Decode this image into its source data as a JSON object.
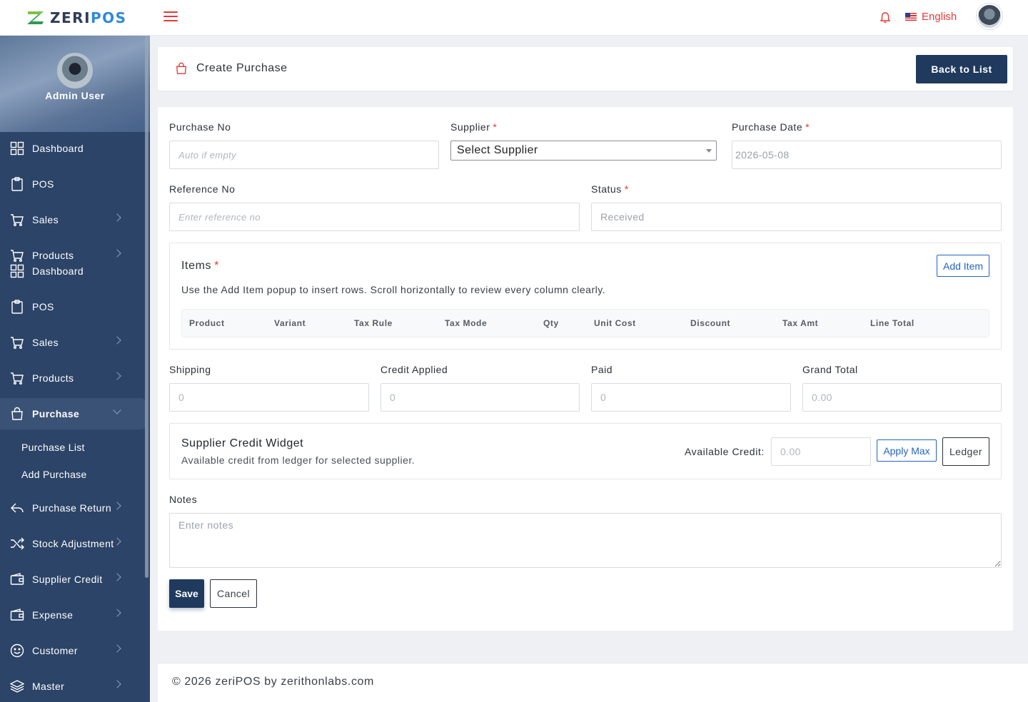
{
  "brand": {
    "part1": "ZERI",
    "part2": "POS"
  },
  "topbar": {
    "language": "English"
  },
  "profile": {
    "name": "Admin User"
  },
  "sidebar": {
    "items": [
      {
        "label": "Dashboard",
        "icon": "grid-icon"
      },
      {
        "label": "POS",
        "icon": "clipboard-icon"
      },
      {
        "label": "Sales",
        "icon": "cart-icon"
      },
      {
        "label": "Products",
        "icon": "cart-icon"
      },
      {
        "label": "Dashboard",
        "icon": "grid-icon"
      },
      {
        "label": "POS",
        "icon": "clipboard-icon"
      },
      {
        "label": "Sales",
        "icon": "cart-icon"
      },
      {
        "label": "Products",
        "icon": "cart-icon"
      },
      {
        "label": "Purchase",
        "icon": "bag-icon"
      },
      {
        "label": "Purchase Return",
        "icon": "return-icon"
      },
      {
        "label": "Stock Adjustment",
        "icon": "shuffle-icon"
      },
      {
        "label": "Supplier Credit",
        "icon": "wallet-icon"
      },
      {
        "label": "Expense",
        "icon": "wallet-icon"
      },
      {
        "label": "Customer",
        "icon": "smile-icon"
      },
      {
        "label": "Master",
        "icon": "layers-icon"
      }
    ],
    "purchase_sub": [
      "Purchase List",
      "Add Purchase"
    ]
  },
  "header": {
    "title": "Create Purchase",
    "back_label": "Back to List"
  },
  "form": {
    "purchase_no": {
      "label": "Purchase No",
      "placeholder": "Auto if empty"
    },
    "supplier": {
      "label": "Supplier",
      "value": "Select Supplier"
    },
    "purchase_date": {
      "label": "Purchase Date",
      "value": "2026-05-08"
    },
    "reference_no": {
      "label": "Reference No",
      "placeholder": "Enter reference no"
    },
    "status": {
      "label": "Status",
      "value": "Received"
    },
    "required_mark": "*"
  },
  "items": {
    "title": "Items",
    "help": "Use the Add Item popup to insert rows. Scroll horizontally to review every column clearly.",
    "add_label": "Add Item",
    "columns": [
      "Product",
      "Variant",
      "Tax Rule",
      "Tax Mode",
      "Qty",
      "Unit Cost",
      "Discount",
      "Tax Amt",
      "Line Total"
    ]
  },
  "totals": {
    "shipping": {
      "label": "Shipping",
      "value": "0"
    },
    "credit_applied": {
      "label": "Credit Applied",
      "value": "0"
    },
    "paid": {
      "label": "Paid",
      "value": "0"
    },
    "grand_total": {
      "label": "Grand Total",
      "value": "0.00"
    }
  },
  "credit_widget": {
    "title": "Supplier Credit Widget",
    "subtitle": "Available credit from ledger for selected supplier.",
    "available_label": "Available Credit:",
    "available_value": "0.00",
    "apply_label": "Apply Max",
    "ledger_label": "Ledger"
  },
  "notes": {
    "label": "Notes",
    "placeholder": "Enter notes"
  },
  "actions": {
    "save": "Save",
    "cancel": "Cancel"
  },
  "footer": {
    "text": "© 2026 zeriPOS by zerithonlabs.com"
  },
  "colors": {
    "sidebar": "#2c4467",
    "primary": "#203a5e",
    "accent": "#e53935",
    "link": "#2264c4"
  }
}
